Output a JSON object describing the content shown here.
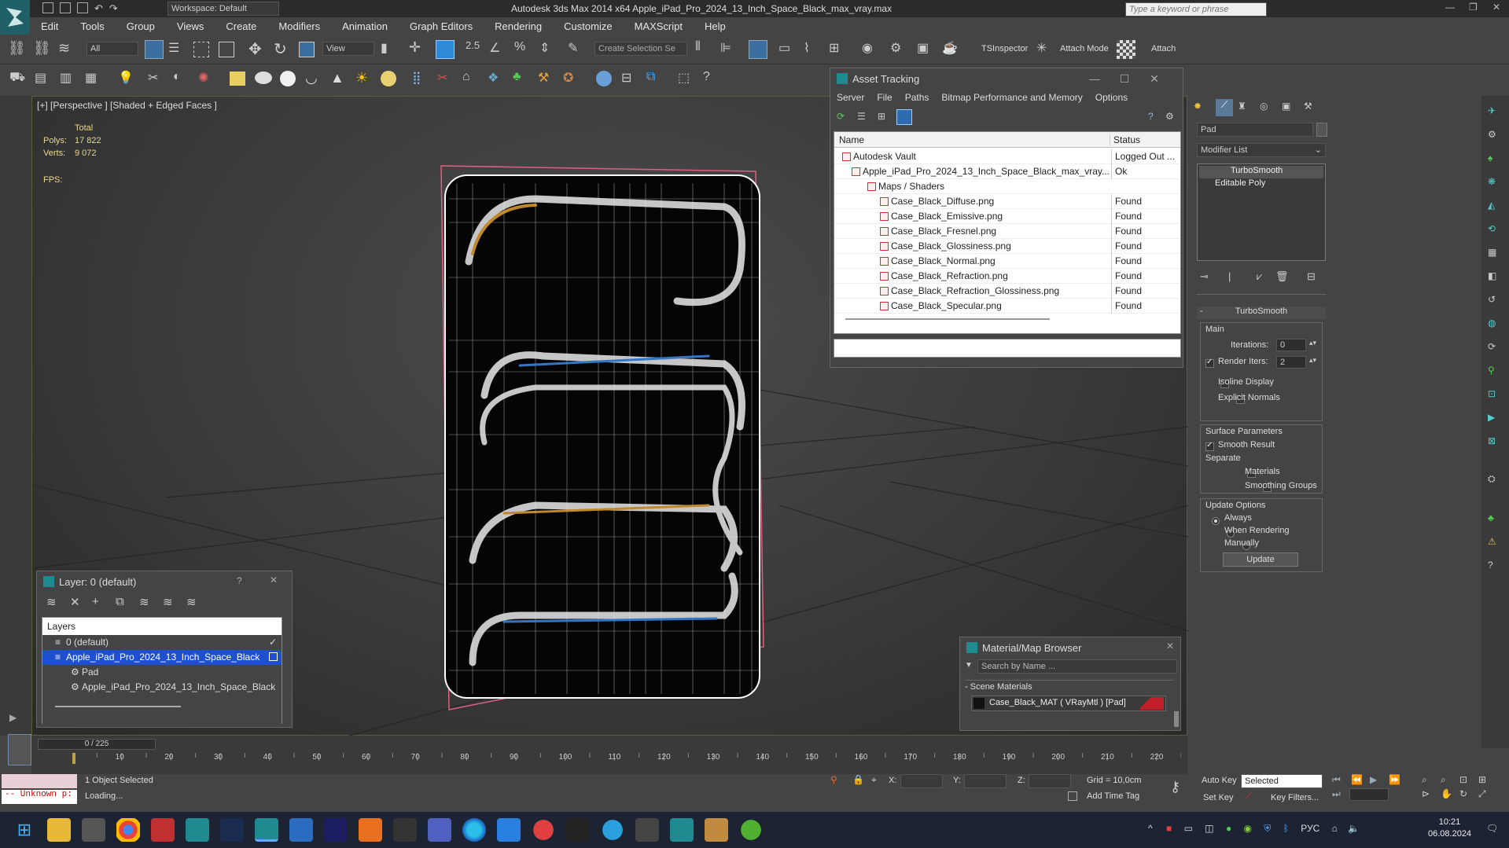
{
  "app": {
    "title": "Autodesk 3ds Max  2014 x64    Apple_iPad_Pro_2024_13_Inch_Space_Black_max_vray.max",
    "workspace": "Workspace: Default",
    "search_placeholder": "Type a keyword or phrase"
  },
  "menu": [
    "Edit",
    "Tools",
    "Group",
    "Views",
    "Create",
    "Modifiers",
    "Animation",
    "Graph Editors",
    "Rendering",
    "Customize",
    "MAXScript",
    "Help"
  ],
  "toolbar": {
    "selection_filter": "All",
    "ref_coord": "View",
    "snap_value": "2.5",
    "named_selection_placeholder": "Create Selection Se",
    "tsinspector": "TSInspector",
    "attach_mode": "Attach Mode",
    "attach": "Attach"
  },
  "viewport": {
    "label": "[+] [Perspective ] [Shaded + Edged Faces ]",
    "stats_total": "Total",
    "polys_label": "Polys:",
    "polys_value": "17 822",
    "verts_label": "Verts:",
    "verts_value": "9 072",
    "fps_label": "FPS:"
  },
  "asset_tracking": {
    "title": "Asset Tracking",
    "menu": [
      "Server",
      "File",
      "Paths",
      "Bitmap Performance and Memory",
      "Options"
    ],
    "col_name": "Name",
    "col_status": "Status",
    "rows": [
      {
        "name": "Autodesk Vault",
        "status": "Logged Out ..."
      },
      {
        "name": "Apple_iPad_Pro_2024_13_Inch_Space_Black_max_vray...",
        "status": "Ok"
      },
      {
        "name": "Maps / Shaders",
        "status": ""
      },
      {
        "name": "Case_Black_Diffuse.png",
        "status": "Found"
      },
      {
        "name": "Case_Black_Emissive.png",
        "status": "Found"
      },
      {
        "name": "Case_Black_Fresnel.png",
        "status": "Found"
      },
      {
        "name": "Case_Black_Glossiness.png",
        "status": "Found"
      },
      {
        "name": "Case_Black_Normal.png",
        "status": "Found"
      },
      {
        "name": "Case_Black_Refraction.png",
        "status": "Found"
      },
      {
        "name": "Case_Black_Refraction_Glossiness.png",
        "status": "Found"
      },
      {
        "name": "Case_Black_Specular.png",
        "status": "Found"
      }
    ]
  },
  "layer_panel": {
    "title": "Layer: 0 (default)",
    "header": "Layers",
    "items": [
      "0 (default)",
      "Apple_iPad_Pro_2024_13_Inch_Space_Black",
      "Pad",
      "Apple_iPad_Pro_2024_13_Inch_Space_Black"
    ]
  },
  "material_browser": {
    "title": "Material/Map Browser",
    "search_placeholder": "Search by Name ...",
    "section": "Scene Materials",
    "material": "Case_Black_MAT  ( VRayMtl )  [Pad]"
  },
  "command_panel": {
    "object_name": "Pad",
    "modifier_list": "Modifier List",
    "stack": [
      "TurboSmooth",
      "Editable Poly"
    ],
    "rollout_title": "TurboSmooth",
    "main_group": "Main",
    "iterations_label": "Iterations:",
    "iterations_value": "0",
    "render_iters_label": "Render Iters:",
    "render_iters_value": "2",
    "isoline": "Isoline Display",
    "explicit_normals": "Explicit Normals",
    "surface_params": "Surface Parameters",
    "smooth_result": "Smooth Result",
    "separate": "Separate",
    "materials": "Materials",
    "smoothing_groups": "Smoothing Groups",
    "update_options": "Update Options",
    "always": "Always",
    "when_rendering": "When Rendering",
    "manually": "Manually",
    "update_button": "Update"
  },
  "timeline": {
    "frame_counter": "0 / 225",
    "ticks": [
      "10",
      "20",
      "30",
      "40",
      "50",
      "60",
      "70",
      "80",
      "90",
      "100",
      "110",
      "120",
      "130",
      "140",
      "150",
      "160",
      "170",
      "180",
      "190",
      "200",
      "210",
      "220"
    ]
  },
  "status": {
    "maxscript": "-- Unknown p:",
    "selected": "1 Object Selected",
    "loading": "Loading...",
    "x_label": "X:",
    "y_label": "Y:",
    "z_label": "Z:",
    "grid": "Grid = 10,0cm",
    "add_time_tag": "Add Time Tag",
    "auto_key": "Auto Key",
    "set_key": "Set Key",
    "selected_dropdown": "Selected",
    "key_filters": "Key Filters..."
  },
  "taskbar": {
    "lang": "РУС",
    "time": "10:21",
    "date": "06.08.2024"
  },
  "colors": {
    "accent_teal": "#1f5f66",
    "selection_blue": "#1f4fd1",
    "material_red": "#c0202a"
  }
}
